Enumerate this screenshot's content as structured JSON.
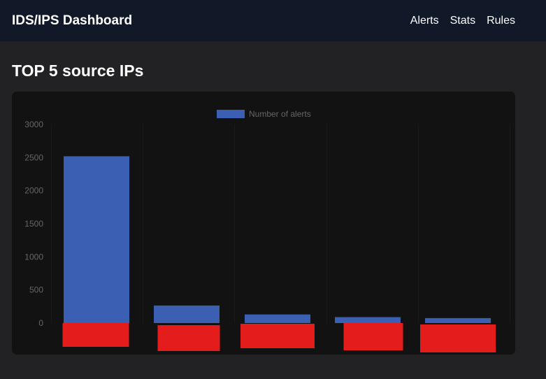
{
  "navbar": {
    "brand": "IDS/IPS Dashboard",
    "links": [
      {
        "label": "Alerts"
      },
      {
        "label": "Stats"
      },
      {
        "label": "Rules"
      }
    ]
  },
  "page": {
    "title": "TOP 5 source IPs"
  },
  "colors": {
    "bar": "#3b5fb2",
    "label_box": "#e51c1c",
    "card": "#121212",
    "navbar": "#111827",
    "background": "#222224"
  },
  "chart_data": {
    "type": "bar",
    "legend_position": "top",
    "series": [
      {
        "name": "Number of alerts",
        "values": [
          2520,
          265,
          130,
          90,
          75
        ]
      }
    ],
    "categories_redacted": true,
    "ylim": [
      0,
      3000
    ],
    "yticks": [
      0,
      500,
      1000,
      1500,
      2000,
      2500,
      3000
    ],
    "grid": false
  }
}
